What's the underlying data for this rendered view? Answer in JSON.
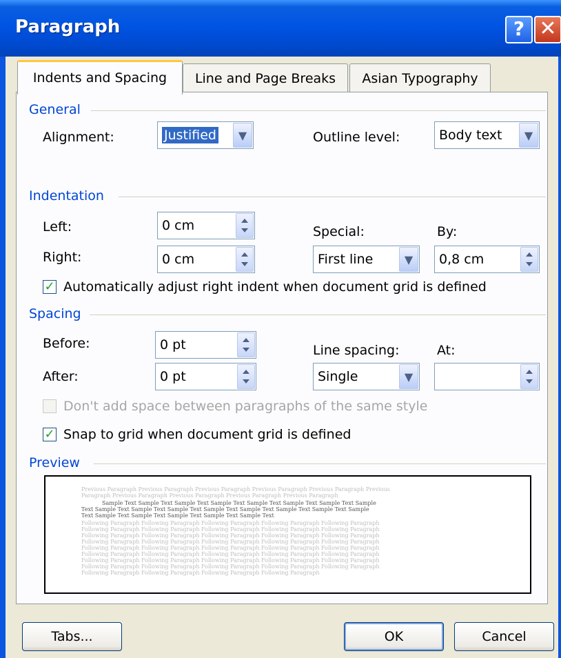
{
  "window": {
    "title": "Paragraph",
    "help_glyph": "?",
    "close_glyph": "✕"
  },
  "tabs": [
    {
      "label": "Indents and Spacing",
      "selected": true
    },
    {
      "label": "Line and Page Breaks",
      "selected": false
    },
    {
      "label": "Asian Typography",
      "selected": false
    }
  ],
  "general": {
    "title": "General",
    "alignment_label": "Alignment:",
    "alignment_value": "Justified",
    "outline_label": "Outline level:",
    "outline_value": "Body text"
  },
  "indentation": {
    "title": "Indentation",
    "left_label": "Left:",
    "left_value": "0 cm",
    "right_label": "Right:",
    "right_value": "0 cm",
    "special_label": "Special:",
    "special_value": "First line",
    "by_label": "By:",
    "by_value": "0,8 cm",
    "auto_adjust_label": "Automatically adjust right indent when document grid is defined",
    "auto_adjust_checked": true
  },
  "spacing": {
    "title": "Spacing",
    "before_label": "Before:",
    "before_value": "0 pt",
    "after_label": "After:",
    "after_value": "0 pt",
    "line_spacing_label": "Line spacing:",
    "line_spacing_value": "Single",
    "at_label": "At:",
    "at_value": "",
    "dont_add_label": "Don't add space between paragraphs of the same style",
    "dont_add_checked": false,
    "snap_label": "Snap to grid when document grid is defined",
    "snap_checked": true
  },
  "preview": {
    "title": "Preview",
    "lines": [
      "Previous Paragraph Previous Paragraph Previous Paragraph Previous Paragraph Previous Paragraph Previous",
      "Paragraph Previous Paragraph Previous Paragraph Previous Paragraph Previous Paragraph",
      "Sample Text Sample Text Sample Text Sample Text Sample Text Sample Text Sample Text Sample",
      "Text Sample Text Sample Text Sample Text Sample Text Sample Text Sample Text Sample Text Sample",
      "Text Sample Text Sample Text Sample Text Sample Text Sample Text",
      "Following Paragraph Following Paragraph Following Paragraph Following Paragraph Following Paragraph",
      "Following Paragraph Following Paragraph Following Paragraph Following Paragraph Following Paragraph",
      "Following Paragraph Following Paragraph Following Paragraph Following Paragraph Following Paragraph",
      "Following Paragraph Following Paragraph Following Paragraph Following Paragraph Following Paragraph",
      "Following Paragraph Following Paragraph Following Paragraph Following Paragraph Following Paragraph",
      "Following Paragraph Following Paragraph Following Paragraph Following Paragraph Following Paragraph",
      "Following Paragraph Following Paragraph Following Paragraph Following Paragraph Following Paragraph",
      "Following Paragraph Following Paragraph Following Paragraph Following Paragraph Following Paragraph",
      "Following Paragraph Following Paragraph Following Paragraph Following Paragraph"
    ]
  },
  "buttons": {
    "tabs": "Tabs...",
    "ok": "OK",
    "cancel": "Cancel"
  },
  "colors": {
    "titlebar": "#0054e3",
    "section_title": "#0046d5",
    "dialog_bg": "#ece9d8",
    "tab_highlight": "#ffc83c"
  }
}
